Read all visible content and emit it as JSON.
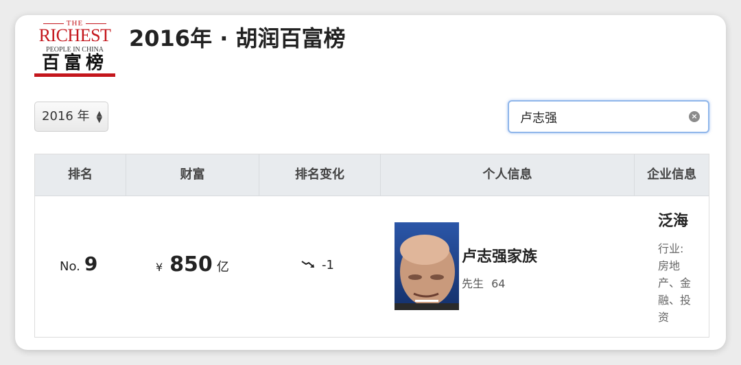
{
  "logo": {
    "the": "THE",
    "richest": "RICHEST",
    "subtitle": "PEOPLE IN CHINA",
    "chinese": "百富榜",
    "brand_color": "#c4161c"
  },
  "header": {
    "title": "2016年 · 胡润百富榜"
  },
  "filters": {
    "year_selected": "2016 年",
    "search_value": "卢志强",
    "clear_icon": "clear-icon"
  },
  "table": {
    "headers": [
      "排名",
      "财富",
      "排名变化",
      "个人信息",
      "企业信息"
    ],
    "rows": [
      {
        "rank_prefix": "No.",
        "rank": "9",
        "currency": "¥",
        "wealth": "850",
        "wealth_unit": "亿",
        "change_icon": "trend-down-icon",
        "change": "-1",
        "name": "卢志强家族",
        "gender": "先生",
        "age": "64",
        "company": "泛海",
        "industry": "行业: 房地产、金融、投资"
      }
    ]
  },
  "colors": {
    "header_bg": "#e8ebee",
    "focus_border": "#8fb6ea"
  }
}
